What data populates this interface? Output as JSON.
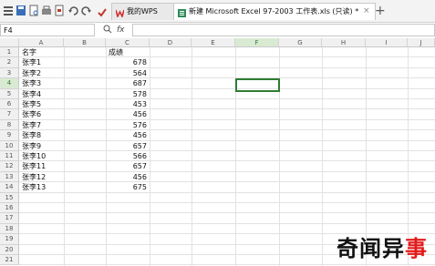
{
  "toolbar": {
    "icons": [
      "app-menu-icon",
      "save-icon",
      "print-preview-icon",
      "print-icon",
      "export-pdf-icon",
      "undo-icon",
      "redo-icon"
    ],
    "tabs": [
      {
        "label": "我的WPS",
        "active": false
      },
      {
        "label": "新建 Microsoft Excel 97-2003 工作表.xls (只读) *",
        "active": true
      }
    ],
    "new_tab_label": "+"
  },
  "formula_bar": {
    "cell_ref": "F4",
    "fx_label": "fx",
    "value": ""
  },
  "sheet": {
    "columns": [
      "A",
      "B",
      "C",
      "D",
      "E",
      "F",
      "G",
      "H",
      "I",
      "J"
    ],
    "rows": [
      "1",
      "2",
      "3",
      "4",
      "5",
      "6",
      "7",
      "8",
      "9",
      "10",
      "11",
      "12",
      "13",
      "14",
      "15",
      "16",
      "17",
      "18",
      "19",
      "20",
      "21"
    ],
    "selected_cell": "F4",
    "header_a1": "名字",
    "header_c1": "成绩",
    "records": [
      {
        "name": "张李1",
        "score": "678"
      },
      {
        "name": "张李2",
        "score": "564"
      },
      {
        "name": "张李3",
        "score": "687"
      },
      {
        "name": "张李4",
        "score": "578"
      },
      {
        "name": "张李5",
        "score": "453"
      },
      {
        "name": "张李6",
        "score": "456"
      },
      {
        "name": "张李7",
        "score": "576"
      },
      {
        "name": "张李8",
        "score": "456"
      },
      {
        "name": "张李9",
        "score": "657"
      },
      {
        "name": "张李10",
        "score": "566"
      },
      {
        "name": "张李11",
        "score": "657"
      },
      {
        "name": "张李12",
        "score": "456"
      },
      {
        "name": "张李13",
        "score": "675"
      }
    ]
  },
  "watermark": {
    "text_black": "奇闻异",
    "text_red": "事"
  },
  "colors": {
    "selection": "#2e7d32",
    "wps_red": "#d32f2f",
    "watermark_red": "#e21a1a"
  }
}
